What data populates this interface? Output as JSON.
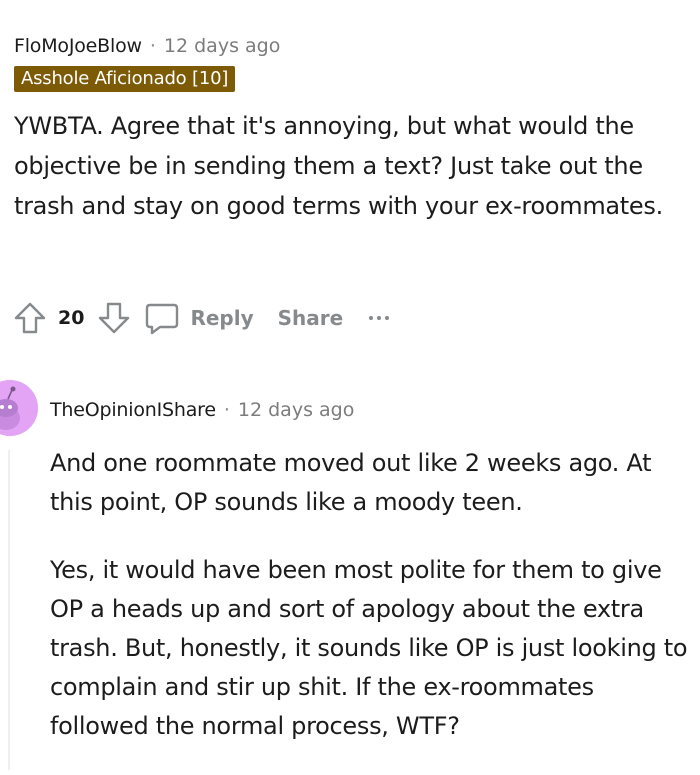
{
  "comment1": {
    "author": "FloMoJoeBlow",
    "separator": "·",
    "time": "12 days ago",
    "flair": "Asshole Aficionado [10]",
    "body": "YWBTA. Agree that it's annoying, but what would the objective be in sending them a text? Just take out the trash and stay on good terms with your ex-roommates.",
    "votes": "20",
    "reply_label": "Reply",
    "share_label": "Share",
    "icons": {
      "upvote": "arrow-up-icon",
      "downvote": "arrow-down-icon",
      "reply": "comment-bubble-icon",
      "more": "ellipsis-icon"
    }
  },
  "comment2": {
    "author": "TheOpinionIShare",
    "separator": "·",
    "time": "12 days ago",
    "paragraphs": [
      "And one roommate moved out like 2 weeks ago. At this point, OP sounds like a moody teen.",
      "Yes, it would have been most polite for them to give OP a heads up and sort of apology about the extra trash. But, honestly, it sounds like OP is just looking to complain and stir up shit. If the ex-roommates followed the normal process, WTF?"
    ],
    "avatar_color": "#e3a4f5"
  },
  "colors": {
    "flair_bg": "#7c5a06",
    "meta_gray": "#7c7c7c",
    "action_gray": "#878a8c",
    "text": "#1c1c1c"
  }
}
